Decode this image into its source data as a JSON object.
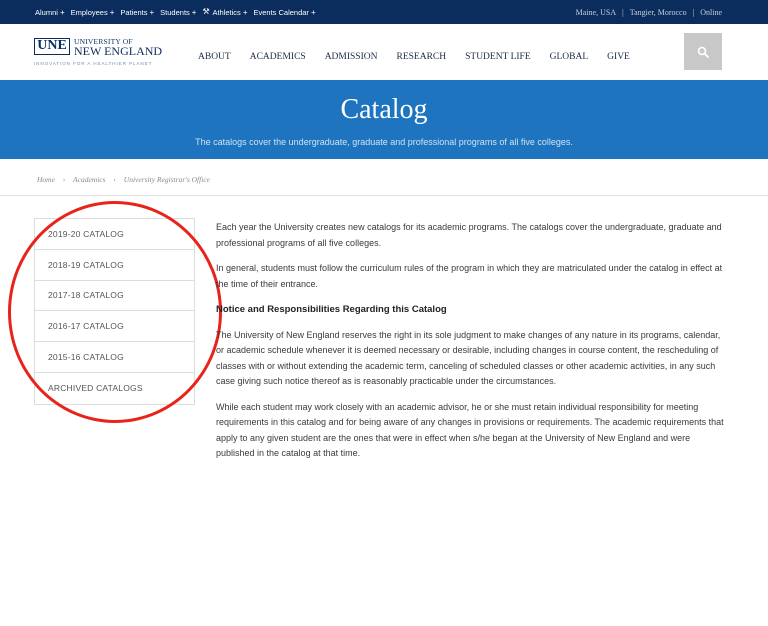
{
  "topbar": {
    "links": [
      "Alumni",
      "Employees",
      "Patients",
      "Students",
      "Athletics",
      "Events Calendar"
    ],
    "campuses": [
      "Maine, USA",
      "Tangier, Morocco",
      "Online"
    ]
  },
  "logo": {
    "abbr": "UNE",
    "line1": "UNIVERSITY OF",
    "line2": "NEW ENGLAND",
    "tagline": "INNOVATION FOR A HEALTHIER PLANET"
  },
  "nav": [
    "ABOUT",
    "ACADEMICS",
    "ADMISSION",
    "RESEARCH",
    "STUDENT LIFE",
    "GLOBAL",
    "GIVE"
  ],
  "hero": {
    "title": "Catalog",
    "subtitle": "The catalogs cover the undergraduate, graduate and professional programs of all five colleges."
  },
  "breadcrumb": [
    "Home",
    "Academics",
    "University Registrar's Office"
  ],
  "sidebar": [
    "2019-20 CATALOG",
    "2018-19 CATALOG",
    "2017-18 CATALOG",
    "2016-17 CATALOG",
    "2015-16 CATALOG",
    "ARCHIVED CATALOGS"
  ],
  "content": {
    "p1": "Each year the University creates new catalogs for its academic programs.  The catalogs cover the undergraduate, graduate and professional programs of all five colleges.",
    "p2": "In general, students must follow the curriculum rules of the program in which they are matriculated under the catalog in effect at the time of their entrance.",
    "heading": "Notice and Responsibilities Regarding this Catalog",
    "p3": "The University of New England reserves the right in its sole judgment to make changes of any nature in its programs, calendar, or academic schedule whenever it is deemed necessary or desirable, including changes in course content, the rescheduling of classes with or without extending the academic term, canceling of scheduled classes or other academic activities, in any such case giving such notice thereof as is reasonably practicable under the circumstances.",
    "p4": "While each student may work closely with an academic advisor, he or she must retain individual responsibility for meeting requirements in this catalog and for being aware of any changes in provisions or requirements. The academic requirements that apply to any given student are the ones that were in effect when s/he began at the University of New England and were published in the catalog at that time."
  },
  "colors": {
    "topbar": "#0b2d5e",
    "hero": "#1f74bf",
    "annotation": "#e8231b"
  }
}
